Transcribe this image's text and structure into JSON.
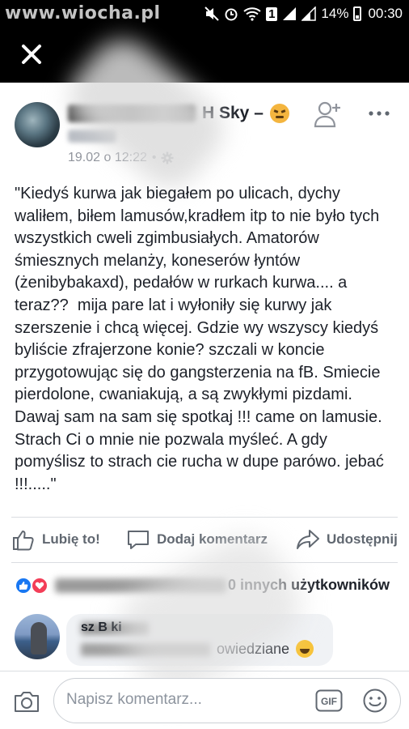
{
  "status_bar": {
    "watermark": "www.wiocha.pl",
    "mini_badge": "1",
    "battery": "14%",
    "time": "00:30"
  },
  "post": {
    "author_visible": "H Sky –",
    "timestamp": "19.02 o 12:22",
    "text": "\"Kiedyś kurwa jak biegałem po ulicach, dychy waliłem, biłem lamusów,kradłem itp to nie było tych wszystkich cweli zgimbusiałych. Amatorów śmiesznych melanży, koneserów łyntów (żenibybakaxd), pedałów w rurkach kurwa.... a teraz??  mija pare lat i wyłoniły się kurwy jak szerszenie i chcą więcej. Gdzie wy wszyscy kiedyś byliście zfrajerzone konie? szczali w koncie przygotowując się do gangsterzenia na fB. Smiecie pierdolone, cwaniakują, a są zwykłymi pizdami. Dawaj sam na sam się spotkaj !!! came on lamusie. Strach Ci o mnie nie pozwala myśleć. A gdy pomyślisz to strach cie rucha w dupe parówo. jebać !!!.....\""
  },
  "actions": {
    "like": "Lubię to!",
    "comment": "Dodaj komentarz",
    "share": "Udostępnij"
  },
  "reactions": {
    "summary_visible": "0 innych użytkowników"
  },
  "comment": {
    "name_visible": "sz B        ki",
    "body_visible": "owiedziane"
  },
  "composer": {
    "placeholder": "Napisz komentarz..."
  },
  "colors": {
    "like_blue": "#1877f2",
    "love_red": "#f33e58",
    "text_dark": "#1d2129",
    "muted": "#606770"
  }
}
